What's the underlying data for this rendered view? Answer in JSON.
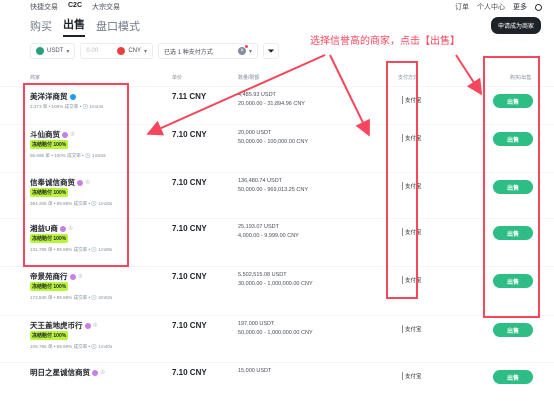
{
  "topnav": {
    "left": [
      "快捷交易",
      "C2C",
      "大宗交易"
    ],
    "active": "C2C",
    "right": [
      "订单",
      "个人中心",
      "更多"
    ]
  },
  "tabs": [
    {
      "label": "购买",
      "active": false
    },
    {
      "label": "出售",
      "active": true
    },
    {
      "label": "盘口模式",
      "active": false
    }
  ],
  "merchant_button": "申请成为商家",
  "filters": {
    "coin": "USDT",
    "amount_placeholder": "0.00",
    "fiat": "CNY",
    "payment": "已选 1 种支付方式"
  },
  "annotation": "选择信誉高的商家，点击【出售】",
  "headers": {
    "merchant": "商家",
    "price": "单价",
    "amount": "数量/限额",
    "payment": "支付方式",
    "action": "购买/出售"
  },
  "rows": [
    {
      "name": "美洋洋商贸",
      "tag": "",
      "stats": "3,373 单 • 100% 成交率 • 🕒 1m24s",
      "price": "7.11 CNY",
      "amount": "4,485.93 USDT",
      "limit": "20,000.00 - 31,894.96 CNY",
      "pay": "支付宝",
      "action": "出售"
    },
    {
      "name": "斗仙商贸",
      "tag": "冻结赔付 100%",
      "stats": "95,695 单 • 100% 成交率 • 🕒 1m53s",
      "price": "7.10 CNY",
      "amount": "20,000 USDT",
      "limit": "50,000.00 - 100,000.00 CNY",
      "pay": "支付宝",
      "action": "出售"
    },
    {
      "name": "信奉诚信商贸",
      "tag": "冻结赔付 100%",
      "stats": "394,205 单 • 99.98% 成交率 • 🕒 1m26s",
      "price": "7.10 CNY",
      "amount": "136,480.74 USDT",
      "limit": "50,000.00 - 969,013.25 CNY",
      "pay": "支付宝",
      "action": "出售"
    },
    {
      "name": "湘益U商",
      "tag": "冻结赔付 100%",
      "stats": "131,796 单 • 99.98% 成交率 • 🕒 1m08s",
      "price": "7.10 CNY",
      "amount": "25,193.07 USDT",
      "limit": "4,000.00 - 9,999.00 CNY",
      "pay": "支付宝",
      "action": "出售"
    },
    {
      "name": "帝景苑商行",
      "tag": "冻结赔付 100%",
      "stats": "173,840 单 • 99.98% 成交率 • 🕒 2m02s",
      "price": "7.10 CNY",
      "amount": "5,502,515.08 USDT",
      "limit": "30,000.00 - 1,000,000.00 CNY",
      "pay": "支付宝",
      "action": "出售"
    },
    {
      "name": "天王盖地虎币行",
      "tag": "冻结赔付 100%",
      "stats": "109,785 单 • 99.99% 成交率 • 🕒 1m40s",
      "price": "7.10 CNY",
      "amount": "197,000 USDT",
      "limit": "50,000.00 - 1,000,000.00 CNY",
      "pay": "支付宝",
      "action": "出售"
    },
    {
      "name": "明日之星诚信商贸",
      "tag": "",
      "stats": "",
      "price": "7.10 CNY",
      "amount": "15,000 USDT",
      "limit": "",
      "pay": "支付宝",
      "action": "出售"
    }
  ],
  "colors": {
    "sell": "#2ebd85",
    "tag": "#b8f43b",
    "annotation": "#f6465d"
  }
}
